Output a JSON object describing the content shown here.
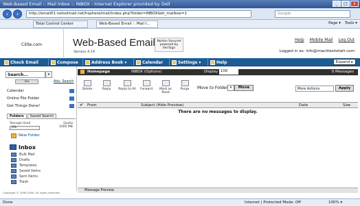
{
  "window": {
    "title": "Web-Based Email :: Mail Inbox :: INBOX - Internet Explorer provided by Dell",
    "min": "_",
    "max": "□",
    "close": "x"
  },
  "addressbar": {
    "back": "‹",
    "forward": "›",
    "url": "http://email01.netsolmail.net/hsphere/mail/index.php?folder=INBOX&bt_mailbox=1",
    "search_placeholder": "Google"
  },
  "tabs": [
    {
      "label": "Total Control Center"
    },
    {
      "label": "Web-Based Email :: Mail I..."
    }
  ],
  "commandbar": {
    "page": "Page ▾",
    "tools": "Tools ▾"
  },
  "header": {
    "logo_text": "Cilite.com",
    "brand": "Web-Based Email",
    "version": "Version 4.14",
    "norton": "Norton Secured\npowered by VeriSign",
    "links": [
      "Help",
      "Mobile Mail",
      "Log Out"
    ],
    "logged_in": "Logged in as: info@imacliteshetatt.com"
  },
  "nav": {
    "items": [
      "Check Email",
      "Compose",
      "Address Book ▾",
      "Calendar",
      "Settings ▾",
      "Help"
    ],
    "expand": "Expand"
  },
  "sidebar": {
    "search_value": "Search...",
    "go_label": "Go",
    "advanced_label": "Adv. Search",
    "links": [
      "Calendar",
      "Online File Folder",
      "Get Things Done!"
    ],
    "tabs": [
      "Folders",
      "Saved Search"
    ],
    "quota_label": "Storage Used",
    "quota_value": "0%",
    "quota_total": "Quota\n1000 MB",
    "new_folder": "New Folder",
    "inbox": "Inbox",
    "folders": [
      "Bulk Mail",
      "Drafts",
      "Templates",
      "Saved Items",
      "Sent Items",
      "Trash"
    ],
    "copyright": "Copyright © 1999-2009. All rights reserved."
  },
  "content": {
    "header_left": "Homepage",
    "header_folder": "INBOX (Options)",
    "display_label": "Display",
    "display_value": "100",
    "message_count": "0 Messages",
    "toolbar": [
      "Delete",
      "Reply",
      "Reply to All",
      "Forward",
      "Mark as Read",
      "Purge"
    ],
    "move_label": "Move to Folder",
    "move_button": "Move",
    "more_actions": "More Actions",
    "apply": "Apply",
    "columns": [
      "From",
      "Subject (Hide Preview)",
      "Date",
      "Size"
    ],
    "empty_message": "There are no messages to display.",
    "preview": "Message Preview"
  },
  "status": {
    "left": "Done",
    "zone": "Internet | Protected Mode: Off",
    "zoom": "100% ▾"
  }
}
